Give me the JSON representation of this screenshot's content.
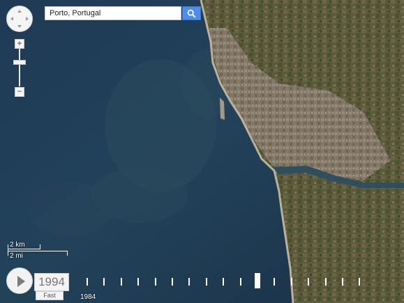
{
  "search": {
    "value": "Porto, Portugal",
    "button_icon": "search-icon"
  },
  "map_controls": {
    "pan_icon": "pan-compass-icon",
    "zoom_in_label": "+",
    "zoom_out_label": "−"
  },
  "scale": {
    "metric": "2 km",
    "imperial": "2 mi"
  },
  "timelapse": {
    "current_year": "1994",
    "speed_label": "Fast",
    "start_year": "1984",
    "play_icon": "play-icon",
    "tick_count": 17,
    "selected_tick_index": 10
  },
  "colors": {
    "search_button": "#4d8ded",
    "ocean": "#1e3550"
  }
}
